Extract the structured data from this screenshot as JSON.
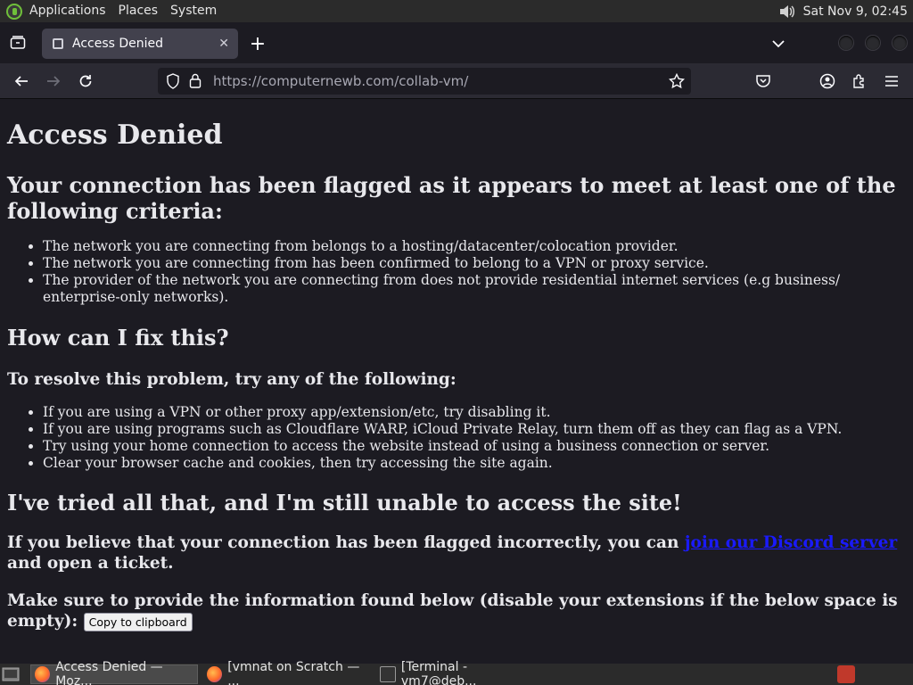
{
  "panel": {
    "menus": [
      "Applications",
      "Places",
      "System"
    ],
    "clock": "Sat Nov 9, 02:45"
  },
  "browser": {
    "tab_title": "Access Denied",
    "url_host": "https://computernewb.com",
    "url_path": "/collab-vm/"
  },
  "page": {
    "h1": "Access Denied",
    "flag_heading": "Your connection has been flagged as it appears to meet at least one of the following criteria:",
    "criteria": [
      "The network you are connecting from belongs to a hosting/datacenter/colocation provider.",
      "The network you are connecting from has been confirmed to belong to a VPN or proxy service.",
      "The provider of the network you are connecting from does not provide residential internet services (e.g business/ enterprise-only networks)."
    ],
    "fix_heading": "How can I fix this?",
    "resolve_heading": "To resolve this problem, try any of the following:",
    "fixes": [
      "If you are using a VPN or other proxy app/extension/etc, try disabling it.",
      "If you are using programs such as Cloudflare WARP, iCloud Private Relay, turn them off as they can flag as a VPN.",
      "Try using your home connection to access the website instead of using a business connection or server.",
      "Clear your browser cache and cookies, then try accessing the site again."
    ],
    "tried_heading": "I've tried all that, and I'm still unable to access the site!",
    "incorrect_prefix": "If you believe that your connection has been flagged incorrectly, you can ",
    "discord_link": "join our Discord server",
    "incorrect_suffix": " and open a ticket.",
    "provide_info": "Make sure to provide the information found below (disable your extensions if the below space is empty): ",
    "copy_button": "Copy to clipboard"
  },
  "taskbar": {
    "tasks": [
      "Access Denied — Moz...",
      "[vmnat on Scratch — ...",
      "[Terminal - vm7@deb..."
    ]
  },
  "colors": {
    "page_bg": "#1c1b22",
    "link": "#1a1aff",
    "toolbar": "#2b2a33"
  }
}
